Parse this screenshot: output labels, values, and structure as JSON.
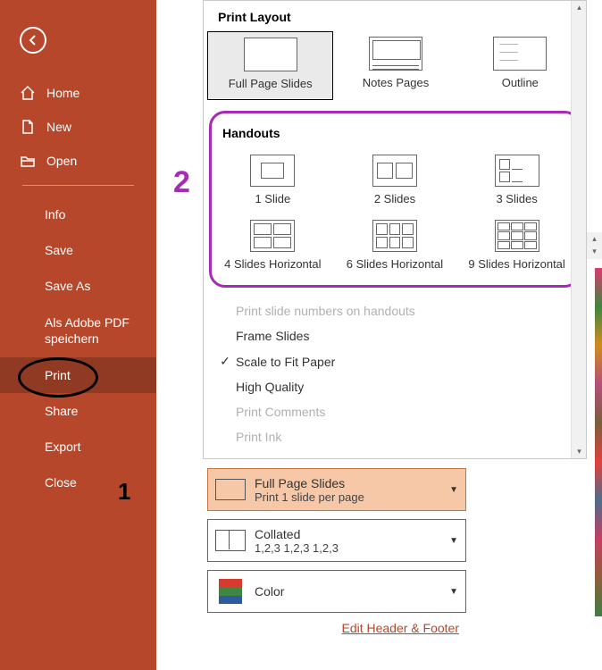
{
  "sidebar": {
    "home": "Home",
    "new": "New",
    "open": "Open",
    "items": [
      "Info",
      "Save",
      "Save As",
      "Als Adobe PDF speichern",
      "Print",
      "Share",
      "Export",
      "Close"
    ]
  },
  "annotations": {
    "one": "1",
    "two": "2"
  },
  "dropdown": {
    "print_layout_header": "Print Layout",
    "layout": [
      {
        "label": "Full Page Slides"
      },
      {
        "label": "Notes Pages"
      },
      {
        "label": "Outline"
      }
    ],
    "handouts_header": "Handouts",
    "handouts": [
      {
        "label": "1 Slide"
      },
      {
        "label": "2 Slides"
      },
      {
        "label": "3 Slides"
      },
      {
        "label": "4 Slides Horizontal"
      },
      {
        "label": "6 Slides Horizontal"
      },
      {
        "label": "9 Slides Horizontal"
      }
    ],
    "options": {
      "print_slide_numbers": "Print slide numbers on handouts",
      "frame_slides": "Frame Slides",
      "scale_to_fit": "Scale to Fit Paper",
      "high_quality": "High Quality",
      "print_comments": "Print Comments",
      "print_ink": "Print Ink"
    }
  },
  "combos": {
    "layout": {
      "title": "Full Page Slides",
      "sub": "Print 1 slide per page"
    },
    "collate": {
      "title": "Collated",
      "sub": "1,2,3   1,2,3   1,2,3"
    },
    "color": {
      "title": "Color"
    }
  },
  "footer_link": "Edit Header & Footer",
  "colors": {
    "brand": "#b7472a",
    "active": "#903a23",
    "highlight": "#a62bb5",
    "combo_bg": "#f6c8a7"
  }
}
